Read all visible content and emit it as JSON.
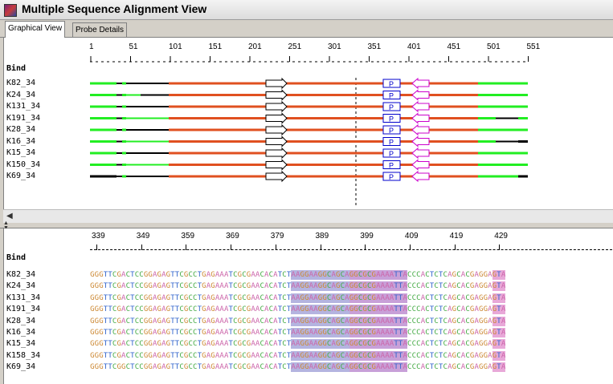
{
  "window": {
    "title": "Multiple Sequence Alignment View"
  },
  "tabs": [
    {
      "label": "Graphical View",
      "active": true
    },
    {
      "label": "Probe Details",
      "active": false
    }
  ],
  "graphical": {
    "ruler_positions": [
      "1",
      "51",
      "101",
      "151",
      "201",
      "251",
      "301",
      "351",
      "401",
      "451",
      "501",
      "551"
    ],
    "header_label": "Bind",
    "rows": [
      "K82_34",
      "K24_34",
      "K131_34",
      "K191_34",
      "K28_34",
      "K16_34",
      "K15_34",
      "K150_34",
      "K69_34"
    ],
    "probe_label": "P",
    "colors": {
      "orange": "#e05020",
      "green": "#22ee22",
      "black": "#000000",
      "blue_box": "#0000cc",
      "purple_arrow": "#cc00cc"
    }
  },
  "detail": {
    "ruler_positions": [
      "339",
      "349",
      "359",
      "369",
      "379",
      "389",
      "399",
      "409",
      "419",
      "429"
    ],
    "header_label": "Bind",
    "rows": [
      "K82_34",
      "K24_34",
      "K131_34",
      "K191_34",
      "K28_34",
      "K16_34",
      "K15_34",
      "K158_34",
      "K69_34"
    ],
    "sequences": [
      "GGGTTCGACTCCGGAGAGTTCGCCTGAGAAATCGCGAACACATCTAAGGAAGGCAGCAGGCGCGAAAATTACCCACTCTCAGCACGAGGAGTA",
      "GGGTTCGACTCCGGAGAGTTCGCCTGAGAAATCGCGAACACATCTAAGGAAGGCAGCAGGCGCGAAAATTACCCACTCTCAGCACGAGGAGTA",
      "GGGTTCGACTCCGGAGAGTTCGCCTGAGAAATCGCGAACACATCTAAGGAAGGCAGCAGGCGCGAAAATTACCCACTCTCAGCACGAGGAGTA",
      "GGGTTCGACTCCGGAGAGTTCGCCTGAGAAATCGCGAACACATCTAAGGAAGGCAGCAGGCGCGAAAATTACCCACTCTCAGCACGAGGAGTA",
      "GGGTTCGACTCCGGAGAGTTCGCCTGAGAAATCGCGAACACATCTAAGGAAGGCAGCAGGCGCGAAAATTACCCACTCTCAGCACGAGGAGTA",
      "GGGTTCGACTCCGGAGAGTTCGCCTGAGAAATCGCGAACACATCTAAGGAAGGCAGCAGGCGCGAAAATTACCCACTCTCAGCACGAGGAGTA",
      "GGGTTCGACTCCGGAGAGTTCGCCTGAGAAATCGCGAACACATCTAAGGAAGGCAGCAGGCGCGAAAATTACCCACTCTCAGCACGAGGAGTA",
      "GGGTTCGACTCCGGAGAGTTCGCCTGAGAAATCGCGAACACATCTAAGGAAGGCAGCAGGCGCGAAAATTACCCACTCTCAGCACGAGGAGTA",
      "GGGTTCGGCTCCGGAGAGTTCGCCTGAGAAATCGCGAACACATCTAAGGAAGGCAGCAGGCGCGAAAATTACCCACTCTCAGCACGAGGAGTA"
    ],
    "base_colors": {
      "A": "#cc66aa",
      "C": "#44aa44",
      "G": "#cc8833",
      "T": "#3366cc"
    },
    "highlight_colors": {
      "probe_region": "#b4b4e0",
      "mid_region": "#c8a0d8",
      "end_region": "#e8a8d8"
    }
  }
}
